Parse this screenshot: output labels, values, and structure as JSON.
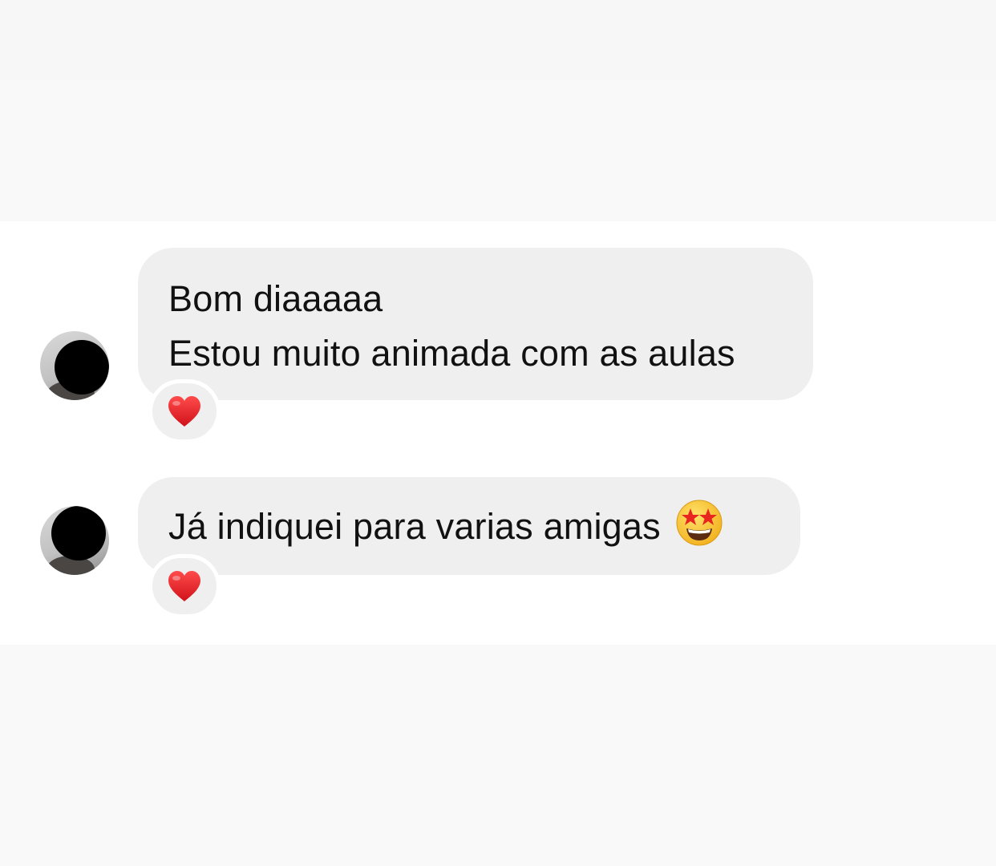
{
  "messages": [
    {
      "lines": [
        "Bom diaaaaa",
        "Estou muito animada com as aulas"
      ],
      "reaction_icon": "red-heart-icon"
    },
    {
      "lines": [
        "Já indiquei para varias amigas"
      ],
      "trailing_emoji": "star-struck-icon",
      "reaction_icon": "red-heart-icon"
    }
  ],
  "colors": {
    "bubble": "#efefef",
    "background_outer": "#f9f9f9",
    "background_chat": "#ffffff",
    "heart": "#e0191f",
    "text": "#111111"
  }
}
